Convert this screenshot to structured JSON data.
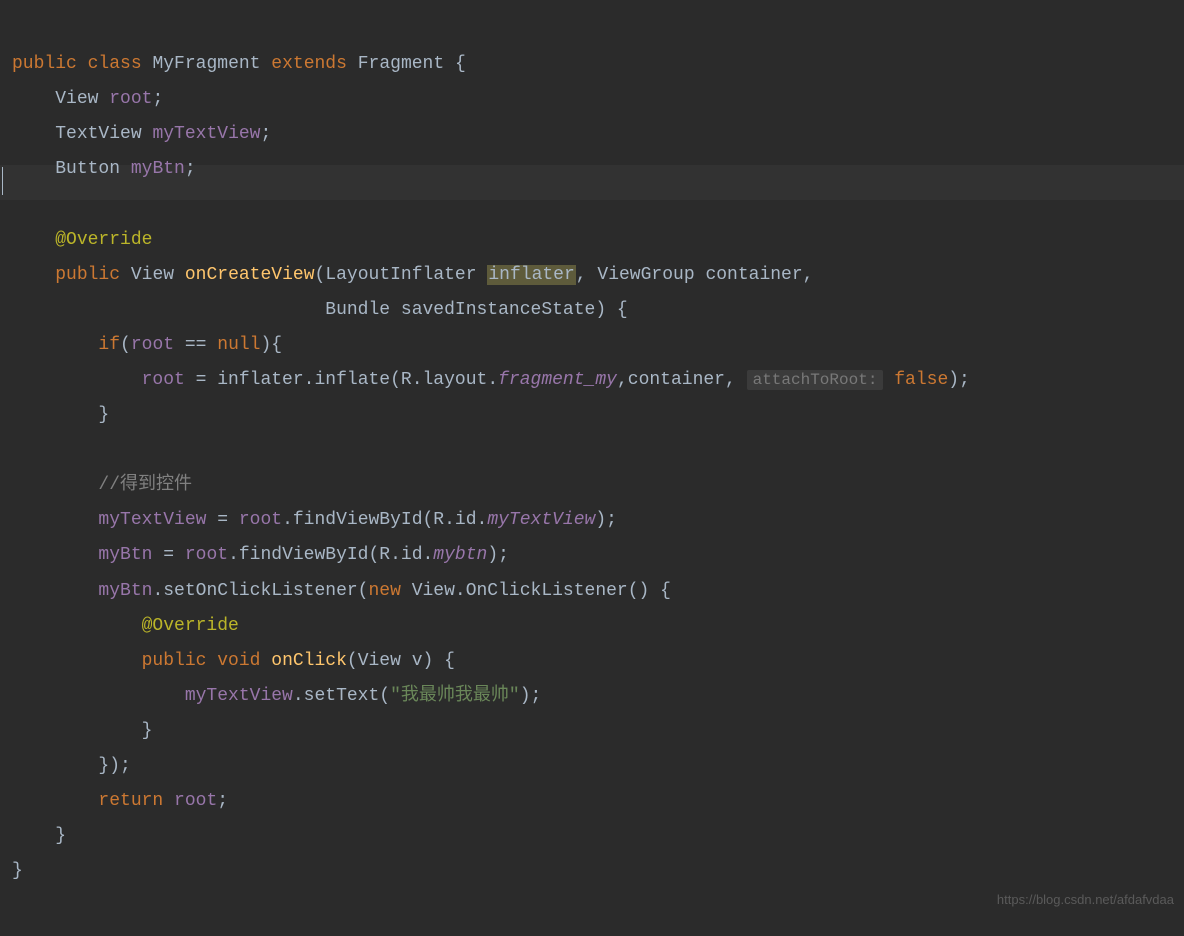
{
  "watermark": "https://blog.csdn.net/afdafvdaa",
  "code": {
    "line1": {
      "kw1": "public",
      "kw2": "class",
      "class_name": "MyFragment",
      "kw3": "extends",
      "super": "Fragment",
      "brace": "{"
    },
    "line2": {
      "type": "View",
      "field": "root",
      "semi": ";"
    },
    "line3": {
      "type": "TextView",
      "field": "myTextView",
      "semi": ";"
    },
    "line4": {
      "type": "Button",
      "field": "myBtn",
      "semi": ";"
    },
    "line6": {
      "annotation": "@Override"
    },
    "line7": {
      "kw": "public",
      "ret": "View",
      "method": "onCreateView",
      "p1t": "LayoutInflater",
      "p1n": "inflater",
      "p2t": "ViewGroup",
      "p2n": "container",
      "comma": ","
    },
    "line8": {
      "p3t": "Bundle",
      "p3n": "savedInstanceState",
      "close": ") {"
    },
    "line9": {
      "kw1": "if",
      "open": "(",
      "field": "root",
      "op": " == ",
      "kw2": "null",
      "close": "){"
    },
    "line10": {
      "field1": "root",
      "eq": " = ",
      "var": "inflater",
      "dot": ".",
      "call": "inflate(R.layout.",
      "italic": "fragment_my",
      "comma": ",",
      "var2": "container",
      "comma2": ", ",
      "hint": "attachToRoot:",
      "kw": "false",
      "close": ");"
    },
    "line11": {
      "brace": "}"
    },
    "line13": {
      "comment": "//得到控件"
    },
    "line14": {
      "field": "myTextView",
      "rest1": " = ",
      "var": "root",
      "rest2": ".findViewById(R.id.",
      "italic": "myTextView",
      "close": ");"
    },
    "line15": {
      "field": "myBtn",
      "rest1": " = ",
      "var": "root",
      "rest2": ".findViewById(R.id.",
      "italic": "mybtn",
      "close": ");"
    },
    "line16": {
      "field": "myBtn",
      "dot": ".",
      "call": "setOnClickListener(",
      "kw": "new",
      "rest": " View.OnClickListener() {"
    },
    "line17": {
      "annotation": "@Override"
    },
    "line18": {
      "kw1": "public",
      "kw2": "void",
      "method": "onClick",
      "params": "(View v) {"
    },
    "line19": {
      "field": "myTextView",
      "dot": ".",
      "call": "setText(",
      "string": "\"我最帅我最帅\"",
      "close": ");"
    },
    "line20": {
      "brace": "}"
    },
    "line21": {
      "close": "});"
    },
    "line22": {
      "kw": "return",
      "field": "root",
      "semi": ";"
    },
    "line23": {
      "brace": "}"
    },
    "line24": {
      "brace": "}"
    }
  }
}
